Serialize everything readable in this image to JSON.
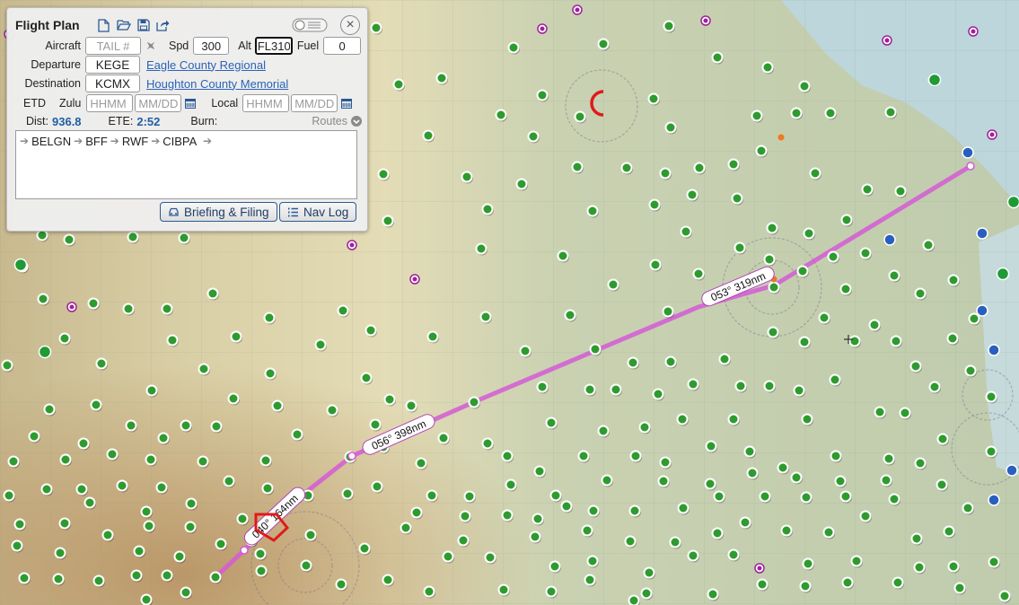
{
  "panel": {
    "title": "Flight Plan",
    "icons": [
      "new-file-icon",
      "open-folder-icon",
      "save-icon",
      "share-icon"
    ],
    "close": "×"
  },
  "aircraft": {
    "label": "Aircraft",
    "tail_placeholder": "TAIL #",
    "speed_label": "Spd",
    "speed": "300",
    "alt_label": "Alt",
    "alt": "FL310",
    "fuel_label": "Fuel",
    "fuel": "0"
  },
  "departure": {
    "label": "Departure",
    "code": "KEGE",
    "name": "Eagle County Regional"
  },
  "destination": {
    "label": "Destination",
    "code": "KCMX",
    "name": "Houghton County Memorial"
  },
  "etd": {
    "label": "ETD",
    "zulu_label": "Zulu",
    "time_placeholder": "HHMM",
    "date_placeholder": "MM/DD",
    "local_label": "Local"
  },
  "stats": {
    "dist_label": "Dist:",
    "dist": "936.8",
    "ete_label": "ETE:",
    "ete": "2:52",
    "burn_label": "Burn:",
    "routes_label": "Routes"
  },
  "route": {
    "waypoints": [
      "BELGN",
      "BFF",
      "RWF",
      "CIBPA"
    ]
  },
  "buttons": {
    "briefing": "Briefing & Filing",
    "navlog": "Nav Log"
  },
  "legs": [
    {
      "label": "040° 164nm"
    },
    {
      "label": "056° 398nm"
    },
    {
      "label": "053° 319nm"
    }
  ],
  "colors": {
    "route": "#d55ad6",
    "airport_green": "#2e9b2e",
    "airport_blue": "#2a5fc0",
    "airport_magenta": "#a0209a",
    "link": "#2a63b8"
  }
}
